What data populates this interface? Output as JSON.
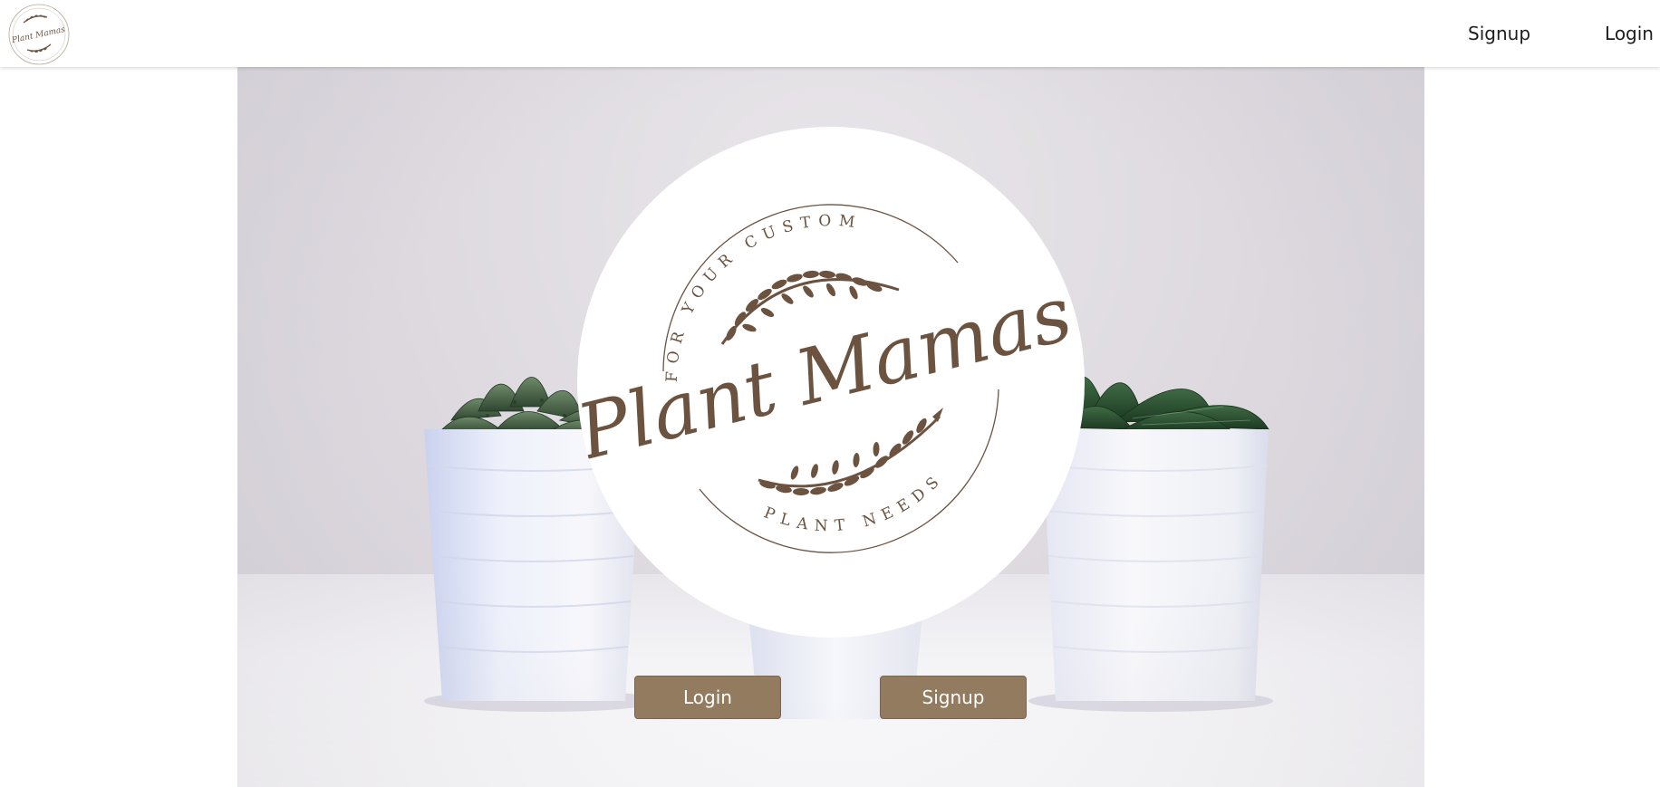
{
  "navbar": {
    "logo_text": "Plant Mamas",
    "links": [
      {
        "label": "Signup"
      },
      {
        "label": "Login"
      }
    ]
  },
  "hero": {
    "logo": {
      "top_arc_text": "FOR YOUR CUSTOM",
      "script_text": "Plant Mamas",
      "bottom_arc_text": "PLANT NEEDS"
    },
    "buttons": {
      "login_label": "Login",
      "signup_label": "Signup"
    }
  },
  "colors": {
    "brand_brown": "#937b60",
    "logo_ink": "#6b5340",
    "nav_text": "#1e1e1e",
    "background": "#ffffff"
  },
  "icons": {
    "nav_logo": "plant-mamas-logo-icon",
    "laurel": "laurel-branch-icon"
  }
}
